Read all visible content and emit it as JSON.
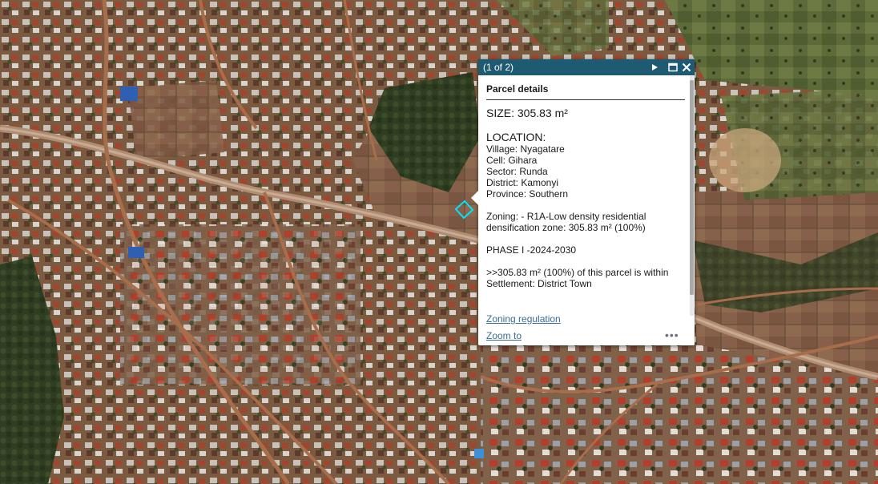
{
  "popup": {
    "counter": "(1 of 2)",
    "title": "Parcel details",
    "size": "SIZE: 305.83 m²",
    "location_heading": "LOCATION:",
    "location_lines": [
      "Village: Nyagatare",
      "Cell: Gihara",
      "Sector: Runda",
      "District: Kamonyi",
      "Province: Southern"
    ],
    "zoning_line1": "Zoning: - R1A-Low density residential",
    "zoning_line2": "densification zone: 305.83 m² (100%)",
    "phase": "PHASE I -2024-2030",
    "settlement_line1": ">>305.83 m² (100%) of this parcel is within",
    "settlement_line2": "Settlement: District Town",
    "link_zoning": "Zoning regulation",
    "link_zoom": "Zoom to",
    "more": "•••"
  },
  "icons": {
    "next": "next-feature-icon",
    "maximize": "maximize-icon",
    "close": "close-icon",
    "more": "more-options-icon"
  },
  "colors": {
    "header": "#1f5a73",
    "selection": "#00e5ff",
    "link": "#3c6e92"
  }
}
